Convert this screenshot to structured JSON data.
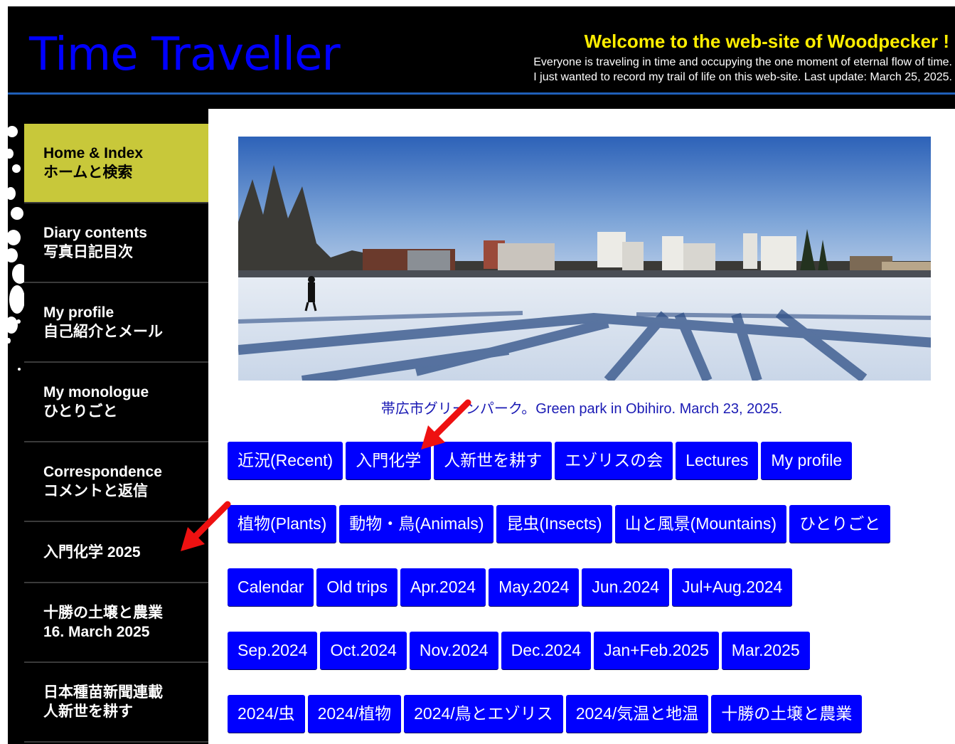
{
  "header": {
    "site_title": "Time Traveller",
    "welcome": "Welcome to the web-site of Woodpecker !",
    "intro_line1": "Everyone is traveling in time and occupying the one moment of eternal flow of time.",
    "intro_line2": "I just wanted to record my trail of life on this web-site.    Last update: March 25, 2025."
  },
  "sidebar": {
    "items": [
      {
        "en": "Home & Index",
        "ja": "ホームと検索"
      },
      {
        "en": "Diary contents",
        "ja": "写真日記目次"
      },
      {
        "en": "My profile",
        "ja": "自己紹介とメール"
      },
      {
        "en": "My monologue",
        "ja": "ひとりごと"
      },
      {
        "en": "Correspondence",
        "ja": "コメントと返信"
      },
      {
        "en": "入門化学 2025",
        "ja": ""
      },
      {
        "en": "十勝の土壌と農業",
        "ja": "16. March 2025"
      },
      {
        "en": "日本種苗新聞連載",
        "ja": "人新世を耕す"
      }
    ]
  },
  "main": {
    "caption": "帯広市グリーンパーク。Green park in Obihiro. March 23, 2025.",
    "rows": [
      [
        "近況(Recent)",
        "入門化学",
        "人新世を耕す",
        "エゾリスの会",
        "Lectures",
        "My profile"
      ],
      [
        "植物(Plants)",
        "動物・鳥(Animals)",
        "昆虫(Insects)",
        "山と風景(Mountains)",
        "ひとりごと"
      ],
      [
        "Calendar",
        "Old trips",
        "Apr.2024",
        "May.2024",
        "Jun.2024",
        "Jul+Aug.2024"
      ],
      [
        "Sep.2024",
        "Oct.2024",
        "Nov.2024",
        "Dec.2024",
        "Jan+Feb.2025",
        "Mar.2025"
      ],
      [
        "2024/虫",
        "2024/植物",
        "2024/鳥とエゾリス",
        "2024/気温と地温",
        "十勝の土壌と農業"
      ]
    ]
  },
  "colors": {
    "title_blue": "#0000ff",
    "welcome_yellow": "#ffee00",
    "active_item": "#c8c83a",
    "button_blue": "#0000ff",
    "arrow_red": "#ee1111"
  }
}
